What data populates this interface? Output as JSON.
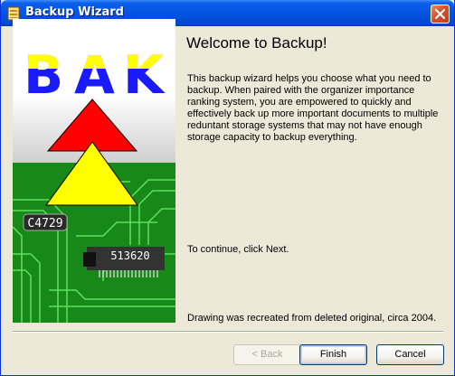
{
  "window": {
    "title": "Backup Wizard"
  },
  "illustration": {
    "logo_letters": [
      "B",
      "A",
      "K"
    ],
    "chip_labels": [
      "C4729",
      "513620"
    ],
    "colors": {
      "red": "#ff0000",
      "yellow": "#ffff00",
      "blue": "#1a1aff",
      "board": "#188818",
      "trace": "#5ee05e"
    }
  },
  "content": {
    "heading": "Welcome to Backup!",
    "description": "This backup wizard helps you choose what you need to backup. When paired with the organizer importance ranking system, you are empowered to quickly and effectively back up more important documents to multiple reduntant storage systems that may not have enough storage capacity to backup everything.",
    "continue_text": "To continue, click Next.",
    "note": "Drawing was recreated from deleted original, circa 2004."
  },
  "buttons": {
    "back": "< Back",
    "finish": "Finish",
    "cancel": "Cancel"
  }
}
